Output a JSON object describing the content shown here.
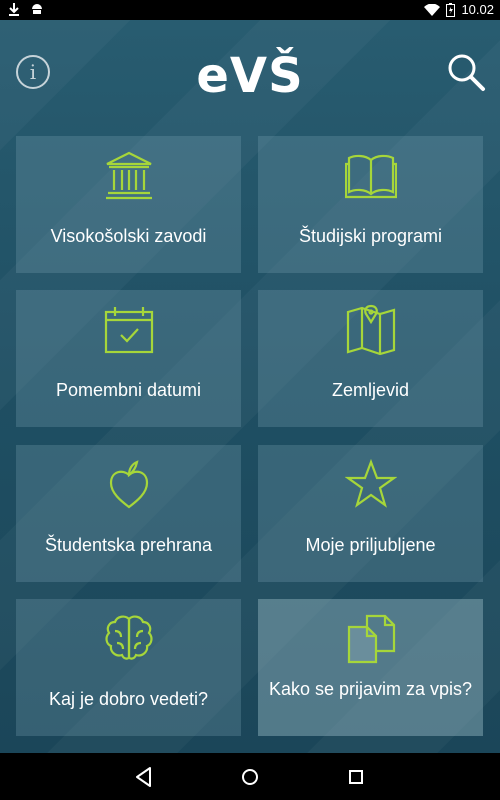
{
  "status_bar": {
    "time": "10.02",
    "battery": ""
  },
  "header": {
    "logo": "eVŠ",
    "info_icon": "info-icon",
    "search_icon": "search-icon"
  },
  "tiles": [
    {
      "label": "Visokošolski zavodi",
      "icon": "institution-icon"
    },
    {
      "label": "Študijski programi",
      "icon": "book-icon"
    },
    {
      "label": "Pomembni datumi",
      "icon": "calendar-icon"
    },
    {
      "label": "Zemljevid",
      "icon": "map-icon"
    },
    {
      "label": "Študentska prehrana",
      "icon": "apple-icon"
    },
    {
      "label": "Moje priljubljene",
      "icon": "star-icon"
    },
    {
      "label": "Kaj je dobro vedeti?",
      "icon": "brain-icon"
    },
    {
      "label": "Kako se prijavim za vpis?",
      "icon": "documents-icon"
    }
  ],
  "colors": {
    "accent": "#a6d63a",
    "background": "#1f4a5e",
    "tile": "#4d7587",
    "tile_highlight": "#6a8e9c"
  },
  "nav": {
    "back_icon": "back-icon",
    "home_icon": "home-icon",
    "recents_icon": "recents-icon"
  }
}
